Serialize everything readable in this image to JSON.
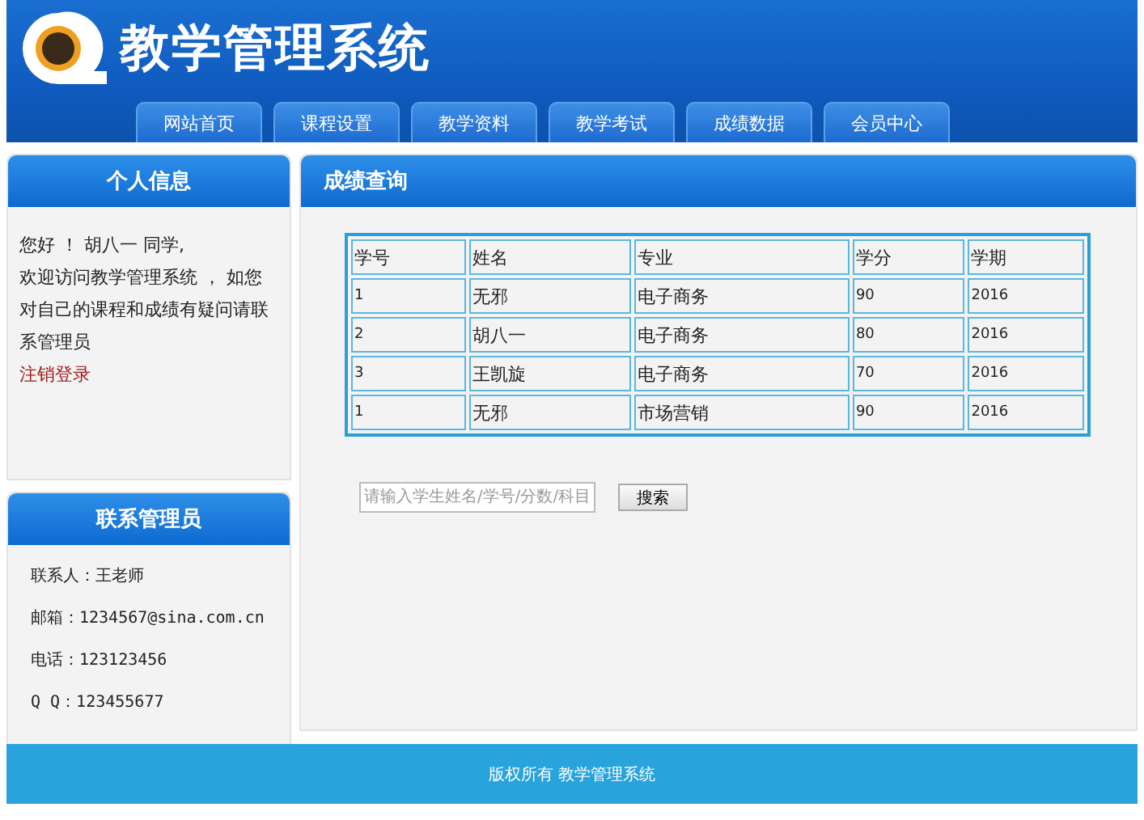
{
  "header": {
    "title": "教学管理系统"
  },
  "nav": [
    "网站首页",
    "课程设置",
    "教学资料",
    "教学考试",
    "成绩数据",
    "会员中心"
  ],
  "profile": {
    "title": "个人信息",
    "greeting": "您好 ！ 胡八一 同学,",
    "message": "欢迎访问教学管理系统 ， 如您对自己的课程和成绩有疑问请联系管理员",
    "logout": "注销登录"
  },
  "contact": {
    "title": "联系管理员",
    "lines": [
      "联系人：王老师",
      "邮箱：1234567@sina.com.cn",
      "电话：123123456",
      "Q Q：123455677"
    ]
  },
  "grades": {
    "title": "成绩查询",
    "columns": [
      "学号",
      "姓名",
      "专业",
      "学分",
      "学期"
    ],
    "rows": [
      [
        "1",
        "无邪",
        "电子商务",
        "90",
        "2016"
      ],
      [
        "2",
        "胡八一",
        "电子商务",
        "80",
        "2016"
      ],
      [
        "3",
        "王凯旋",
        "电子商务",
        "70",
        "2016"
      ],
      [
        "1",
        "无邪",
        "市场营销",
        "90",
        "2016"
      ]
    ],
    "search": {
      "placeholder": "请输入学生姓名/学号/分数/科目",
      "button": "搜索"
    }
  },
  "footer": "版权所有 教学管理系统"
}
